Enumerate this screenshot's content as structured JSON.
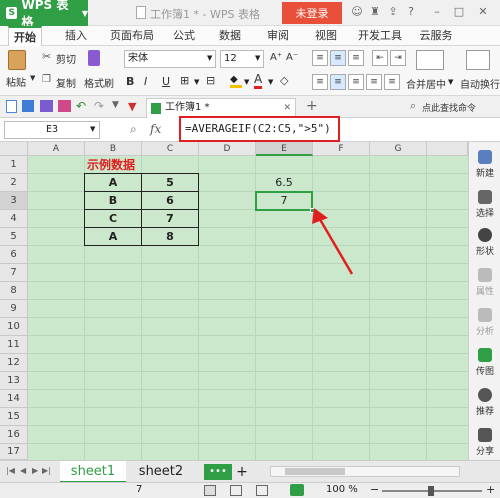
{
  "titlebar": {
    "app_name": "WPS 表格",
    "document_title": "工作簿1 * - WPS 表格",
    "login_button": "未登录"
  },
  "menu": {
    "tabs": [
      "开始",
      "插入",
      "页面布局",
      "公式",
      "数据",
      "审阅",
      "视图",
      "开发工具",
      "云服务"
    ]
  },
  "ribbon": {
    "paste": "粘贴",
    "cut": "剪切",
    "copy": "复制",
    "format_painter": "格式刷",
    "font_name": "宋体",
    "font_size": "12",
    "bold": "B",
    "italic": "I",
    "underline": "U",
    "merge_center": "合并居中",
    "auto_wrap": "自动换行"
  },
  "doc_tabs": {
    "active_tab": "工作簿1 *",
    "search_label": "点此查找命令"
  },
  "formula_bar": {
    "name_box": "E3",
    "fx": "fx",
    "formula": "=AVERAGEIF(C2:C5,\">5\")"
  },
  "sheet": {
    "columns": [
      "A",
      "B",
      "C",
      "D",
      "E",
      "F",
      "G"
    ],
    "rows": [
      "1",
      "2",
      "3",
      "4",
      "5",
      "6",
      "7",
      "8",
      "9",
      "10",
      "11",
      "12",
      "13",
      "14",
      "15",
      "16",
      "17"
    ],
    "header_cell": "示例数据",
    "table": [
      [
        "A",
        "5"
      ],
      [
        "B",
        "6"
      ],
      [
        "C",
        "7"
      ],
      [
        "A",
        "8"
      ]
    ],
    "e2": "6.5",
    "e3": "7"
  },
  "right_panel": {
    "items": [
      "新建",
      "选择",
      "形状",
      "属性",
      "分析",
      "传图",
      "推荐",
      "分享"
    ]
  },
  "sheet_tabs": {
    "tabs": [
      "sheet1",
      "sheet2"
    ],
    "more": "•••",
    "add": "+"
  },
  "status": {
    "value": "7",
    "zoom": "100 %"
  },
  "colors": {
    "accent": "#2f9e44",
    "login": "#e8503a",
    "grid_bg": "#cce8cc",
    "highlight": "#e02020",
    "header_red": "#e02020"
  }
}
